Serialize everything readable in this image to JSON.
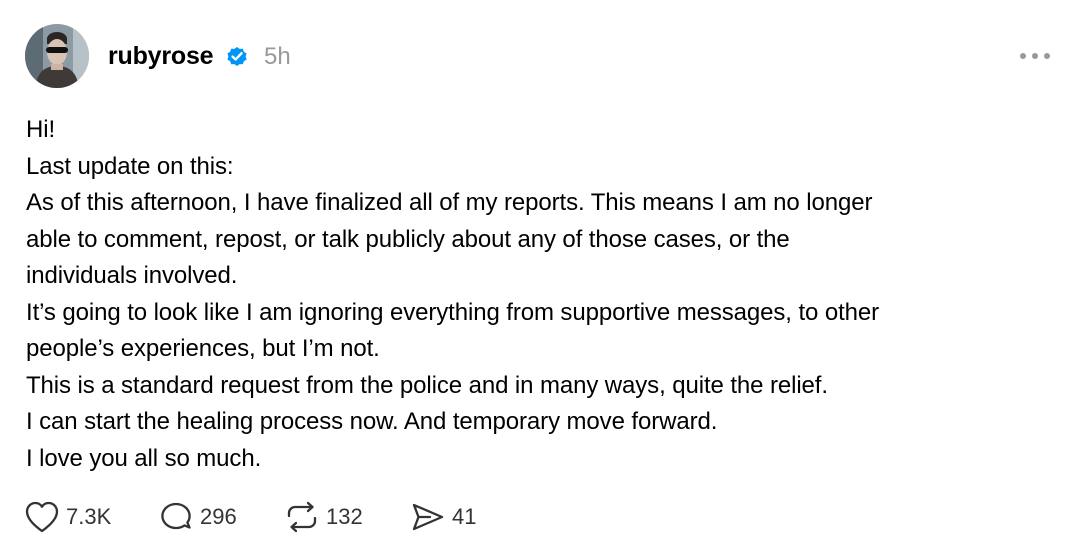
{
  "post": {
    "username": "rubyrose",
    "time": "5h",
    "body_lines": [
      "Hi!",
      "Last update on this:",
      "As of this afternoon, I have finalized all of my reports. This means I am no longer",
      "able to comment, repost, or talk publicly about any of those cases, or the",
      "individuals involved.",
      "It’s going to look like I am ignoring everything from supportive messages, to other",
      "people’s experiences, but I’m not.",
      "This is a standard request from the police and in many ways, quite the relief.",
      "I can start the healing process now. And temporary move forward.",
      "I love you all so much."
    ],
    "actions": {
      "like_count": "7.3K",
      "reply_count": "296",
      "repost_count": "132",
      "share_count": "41"
    }
  },
  "icons": {
    "verified": "verified-badge-icon",
    "more": "more-options-icon",
    "like": "heart-icon",
    "reply": "comment-icon",
    "repost": "repost-icon",
    "share": "send-icon"
  },
  "colors": {
    "verified_blue": "#0095F6",
    "timestamp_gray": "#999999",
    "icon_dark": "#333333"
  }
}
